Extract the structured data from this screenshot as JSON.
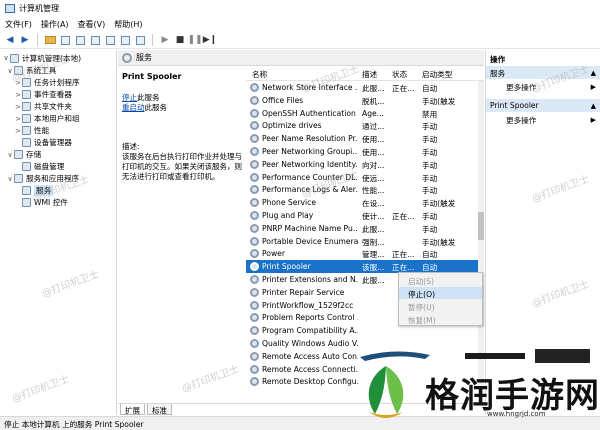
{
  "window": {
    "title": "计算机管理"
  },
  "menu": [
    "文件(F)",
    "操作(A)",
    "查看(V)",
    "帮助(H)"
  ],
  "tree": [
    {
      "label": "计算机管理(本地)",
      "level": 0,
      "arrow": "∨"
    },
    {
      "label": "系统工具",
      "level": 1,
      "arrow": "∨"
    },
    {
      "label": "任务计划程序",
      "level": 2,
      "arrow": ">"
    },
    {
      "label": "事件查看器",
      "level": 2,
      "arrow": ">"
    },
    {
      "label": "共享文件夹",
      "level": 2,
      "arrow": ">"
    },
    {
      "label": "本地用户和组",
      "level": 2,
      "arrow": ">"
    },
    {
      "label": "性能",
      "level": 2,
      "arrow": ">"
    },
    {
      "label": "设备管理器",
      "level": 2,
      "arrow": ""
    },
    {
      "label": "存储",
      "level": 1,
      "arrow": "∨"
    },
    {
      "label": "磁盘管理",
      "level": 2,
      "arrow": ""
    },
    {
      "label": "服务和应用程序",
      "level": 1,
      "arrow": "∨"
    },
    {
      "label": "服务",
      "level": 2,
      "arrow": "",
      "selected": true
    },
    {
      "label": "WMI 控件",
      "level": 2,
      "arrow": ""
    }
  ],
  "mid_header": {
    "title": "服务"
  },
  "detail": {
    "service_title": "Print Spooler",
    "stop_link": "停止",
    "stop_suffix": "此服务",
    "restart_link": "重启动",
    "restart_suffix": "此服务",
    "desc_heading": "描述:",
    "description": "该服务在后台执行打印作业并处理与打印机的交互。如果关闭该服务，则无法进行打印或查看打印机。"
  },
  "columns": {
    "name": "名称",
    "desc": "描述",
    "status": "状态",
    "start": "启动类型"
  },
  "services": [
    {
      "name": "Network Store Interface ...",
      "desc": "此服...",
      "status": "正在...",
      "start": "自动"
    },
    {
      "name": "Office Files",
      "desc": "脱机...",
      "status": "",
      "start": "手动(触发"
    },
    {
      "name": "OpenSSH Authentication ...",
      "desc": "Age...",
      "status": "",
      "start": "禁用"
    },
    {
      "name": "Optimize drives",
      "desc": "通过...",
      "status": "",
      "start": "手动"
    },
    {
      "name": "Peer Name Resolution Pr...",
      "desc": "使用...",
      "status": "",
      "start": "手动"
    },
    {
      "name": "Peer Networking Groupi...",
      "desc": "使用...",
      "status": "",
      "start": "手动"
    },
    {
      "name": "Peer Networking Identity...",
      "desc": "向对...",
      "status": "",
      "start": "手动"
    },
    {
      "name": "Performance Counter DL...",
      "desc": "使远...",
      "status": "",
      "start": "手动"
    },
    {
      "name": "Performance Logs & Aler...",
      "desc": "性能...",
      "status": "",
      "start": "手动"
    },
    {
      "name": "Phone Service",
      "desc": "在设...",
      "status": "",
      "start": "手动(触发"
    },
    {
      "name": "Plug and Play",
      "desc": "使计...",
      "status": "正在...",
      "start": "手动"
    },
    {
      "name": "PNRP Machine Name Pu...",
      "desc": "此服...",
      "status": "",
      "start": "手动"
    },
    {
      "name": "Portable Device Enumera...",
      "desc": "强制...",
      "status": "",
      "start": "手动(触发"
    },
    {
      "name": "Power",
      "desc": "管理...",
      "status": "正在...",
      "start": "自动"
    },
    {
      "name": "Print Spooler",
      "desc": "该服...",
      "status": "正在...",
      "start": "自动",
      "selected": true
    },
    {
      "name": "Printer Extensions and N...",
      "desc": "此服...",
      "status": "",
      "start": "手动"
    },
    {
      "name": "Printer Repair Service",
      "desc": "",
      "status": "",
      "start": ""
    },
    {
      "name": "PrintWorkflow_1529f2cc",
      "desc": "",
      "status": "",
      "start": ""
    },
    {
      "name": "Problem Reports Control ...",
      "desc": "",
      "status": "",
      "start": ""
    },
    {
      "name": "Program Compatibility A...",
      "desc": "",
      "status": "",
      "start": ""
    },
    {
      "name": "Quality Windows Audio V...",
      "desc": "",
      "status": "",
      "start": ""
    },
    {
      "name": "Remote Access Auto Con...",
      "desc": "",
      "status": "",
      "start": ""
    },
    {
      "name": "Remote Access Connecti...",
      "desc": "",
      "status": "",
      "start": ""
    },
    {
      "name": "Remote Desktop Configu...",
      "desc": "",
      "status": "",
      "start": ""
    }
  ],
  "context_menu": [
    {
      "label": "启动(S)",
      "disabled": true
    },
    {
      "label": "停止(O)",
      "disabled": false,
      "hover": true
    },
    {
      "label": "暂停(U)",
      "disabled": true
    },
    {
      "label": "恢复(M)",
      "disabled": true
    }
  ],
  "tabs": {
    "extended": "扩展",
    "standard": "标准"
  },
  "actions": {
    "heading": "操作",
    "group1": "服务",
    "more1": "更多操作",
    "group2": "Print Spooler",
    "more2": "更多操作"
  },
  "statusbar": "停止 本地计算机 上的服务 Print Spooler",
  "watermark": "@打印机卫士",
  "logo": {
    "text": "格润手游网",
    "url": "www.hngrjd.com"
  }
}
